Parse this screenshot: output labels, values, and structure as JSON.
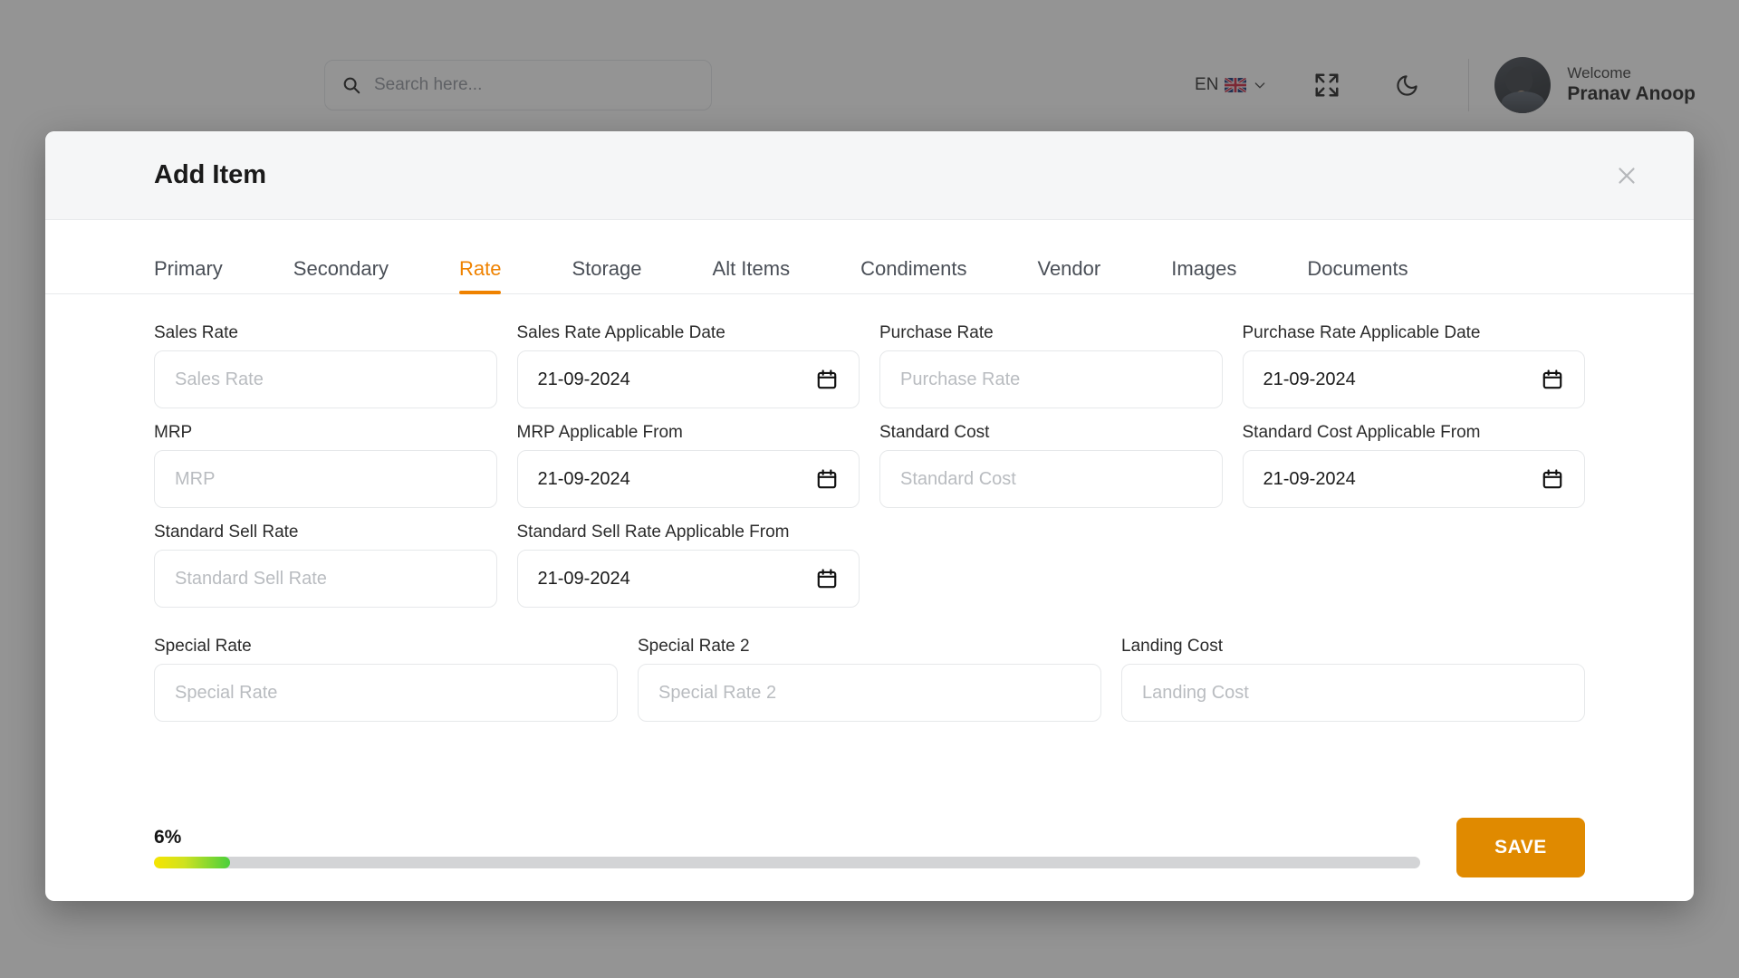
{
  "topbar": {
    "search": {
      "placeholder": "Search here...",
      "value": "",
      "icon": "search-icon"
    },
    "language": {
      "code": "EN",
      "flag": "uk-flag-icon",
      "chevron": "chevron-down-icon"
    },
    "fullscreen_icon": "fullscreen-expand-icon",
    "theme_icon": "moon-dark-mode-icon",
    "user": {
      "greeting": "Welcome",
      "name": "Pranav Anoop",
      "avatar": "user-avatar"
    }
  },
  "modal": {
    "title": "Add Item",
    "close_icon": "close-x-icon",
    "tabs": [
      {
        "label": "Primary",
        "active": false
      },
      {
        "label": "Secondary",
        "active": false
      },
      {
        "label": "Rate",
        "active": true
      },
      {
        "label": "Storage",
        "active": false
      },
      {
        "label": "Alt Items",
        "active": false
      },
      {
        "label": "Condiments",
        "active": false
      },
      {
        "label": "Vendor",
        "active": false
      },
      {
        "label": "Images",
        "active": false
      },
      {
        "label": "Documents",
        "active": false
      }
    ],
    "accent_color": "#ef8200",
    "fields": [
      {
        "label": "Sales Rate",
        "placeholder": "Sales Rate",
        "value": "",
        "type": "text"
      },
      {
        "label": "Sales Rate Applicable Date",
        "placeholder": "",
        "value": "21-09-2024",
        "type": "date"
      },
      {
        "label": "Purchase Rate",
        "placeholder": "Purchase Rate",
        "value": "",
        "type": "text"
      },
      {
        "label": "Purchase Rate Applicable Date",
        "placeholder": "",
        "value": "21-09-2024",
        "type": "date"
      },
      {
        "label": "MRP",
        "placeholder": "MRP",
        "value": "",
        "type": "text"
      },
      {
        "label": "MRP Applicable From",
        "placeholder": "",
        "value": "21-09-2024",
        "type": "date"
      },
      {
        "label": "Standard Cost",
        "placeholder": "Standard Cost",
        "value": "",
        "type": "text"
      },
      {
        "label": "Standard Cost Applicable From",
        "placeholder": "",
        "value": "21-09-2024",
        "type": "date"
      },
      {
        "label": "Standard Sell Rate",
        "placeholder": "Standard Sell Rate",
        "value": "",
        "type": "text"
      },
      {
        "label": "Standard Sell Rate Applicable From",
        "placeholder": "",
        "value": "21-09-2024",
        "type": "date"
      }
    ],
    "wide_fields": [
      {
        "label": "Special Rate",
        "placeholder": "Special Rate",
        "value": ""
      },
      {
        "label": "Special Rate 2",
        "placeholder": "Special Rate 2",
        "value": ""
      },
      {
        "label": "Landing Cost",
        "placeholder": "Landing Cost",
        "value": ""
      }
    ],
    "footer": {
      "progress_label": "6%",
      "progress_value": 6,
      "save_label": "SAVE",
      "save_color": "#e08a00"
    }
  }
}
